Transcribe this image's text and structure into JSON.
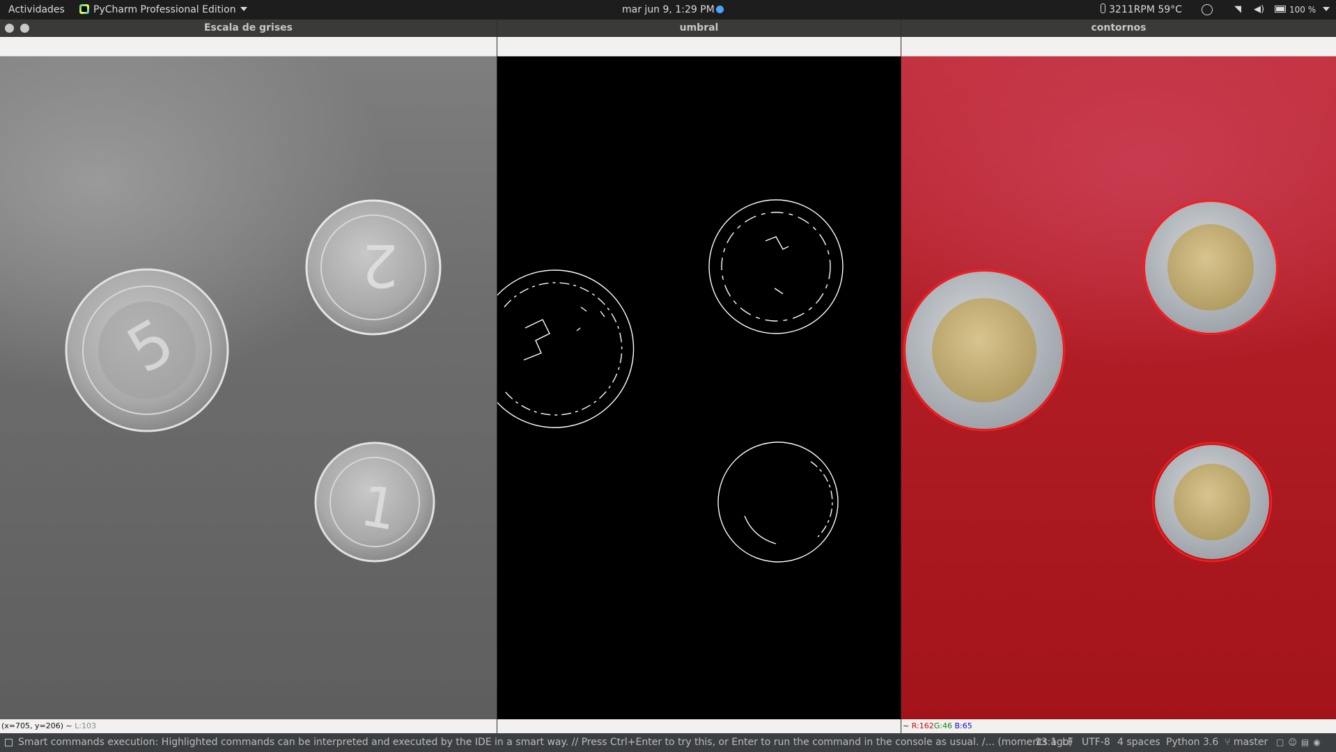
{
  "topbar": {
    "activities": "Actividades",
    "app_name": "PyCharm Professional Edition",
    "clock": "mar jun  9,  1:29 PM",
    "sensors": "3211RPM 59°C",
    "battery": "100 %"
  },
  "windows": {
    "gray": {
      "title": "Escala de grises",
      "status_coords": "(x=705, y=206) ~",
      "status_level": "L:103"
    },
    "umbral": {
      "title": "umbral"
    },
    "contornos": {
      "title": "contornos",
      "status_prefix": "~",
      "status_r": "R:162",
      "status_g": "G:46",
      "status_b": "B:65"
    }
  },
  "ide_status": {
    "message": "Smart commands execution: Highlighted commands can be interpreted and executed by the IDE in a smart way. // Press Ctrl+Enter to try this, or Enter to run the command in the console as usual. /... (moments ago)",
    "position": "13:1",
    "line_sep": "LF",
    "encoding": "UTF-8",
    "indent": "4 spaces",
    "interpreter": "Python 3.6",
    "branch": "master"
  },
  "colors": {
    "contour": "#ff1a1a",
    "red_background": "#b01c24",
    "gray_background": "#6d6d6d",
    "edge_background": "#000000"
  }
}
